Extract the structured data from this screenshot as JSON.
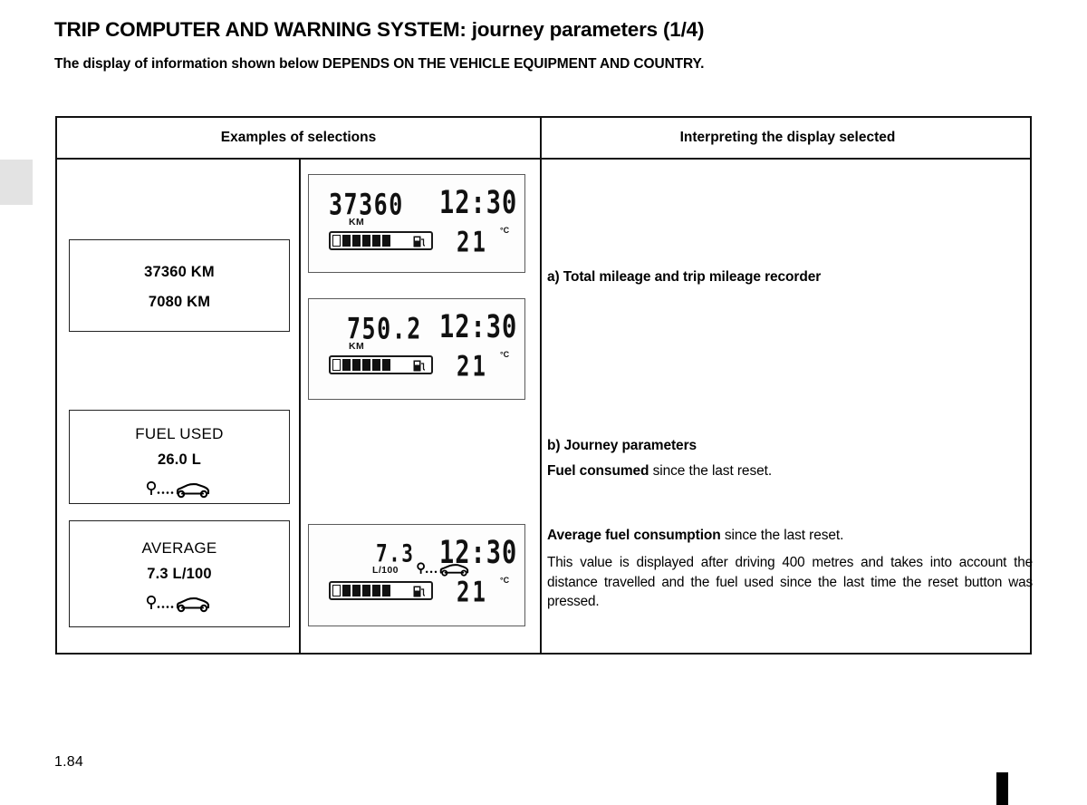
{
  "page": {
    "title": "TRIP COMPUTER AND WARNING SYSTEM: journey parameters (1/4)",
    "subtitle": "The display of information shown below DEPENDS ON THE VEHICLE EQUIPMENT AND COUNTRY.",
    "number": "1.84"
  },
  "table": {
    "headers": {
      "left": "Examples of selections",
      "right": "Interpreting the display selected"
    }
  },
  "selections": [
    {
      "id": "mileage",
      "line1": "37360 KM",
      "line2": "7080 KM",
      "icon": null
    },
    {
      "id": "fuel-used",
      "label": "FUEL USED",
      "value": "26.0 L",
      "icon": "journey-pin-car-icon"
    },
    {
      "id": "average",
      "label": "AVERAGE",
      "value": "7.3 L/100",
      "icon": "journey-pin-car-icon"
    }
  ],
  "lcd_displays": [
    {
      "id": "total-mileage",
      "value": "37360",
      "unit": "KM",
      "clock": "12:30",
      "temperature": "21",
      "temperature_unit": "°C",
      "fuel_gauge_segments": 6,
      "fuel_gauge_total": 11,
      "icons": [
        "fuel-pump-icon"
      ]
    },
    {
      "id": "trip-mileage",
      "value": "750.2",
      "unit": "KM",
      "clock": "12:30",
      "temperature": "21",
      "temperature_unit": "°C",
      "fuel_gauge_segments": 6,
      "fuel_gauge_total": 11,
      "icons": [
        "fuel-pump-icon"
      ]
    },
    {
      "id": "average-consumption",
      "value": "7.3",
      "unit": "L/100",
      "clock": "12:30",
      "temperature": "21",
      "temperature_unit": "°C",
      "fuel_gauge_segments": 6,
      "fuel_gauge_total": 11,
      "icons": [
        "fuel-pump-icon",
        "journey-pin-car-icon"
      ]
    }
  ],
  "interpretations": {
    "a": {
      "heading": "a) Total mileage and trip mileage recorder"
    },
    "b": {
      "heading": "b) Journey parameters",
      "line_bold": "Fuel consumed",
      "line_rest": " since the last reset."
    },
    "c": {
      "line_bold": "Average fuel consumption",
      "line_rest": " since the last reset.",
      "paragraph": "This value is displayed after driving 400 metres and takes into account the distance travelled and the fuel used since the last time the reset button was pressed."
    }
  },
  "colors": {
    "ink": "#000000",
    "table_border": "#111111",
    "edge_tab": "#e3e3e3",
    "lcd_bg": "#fdfdfd"
  }
}
